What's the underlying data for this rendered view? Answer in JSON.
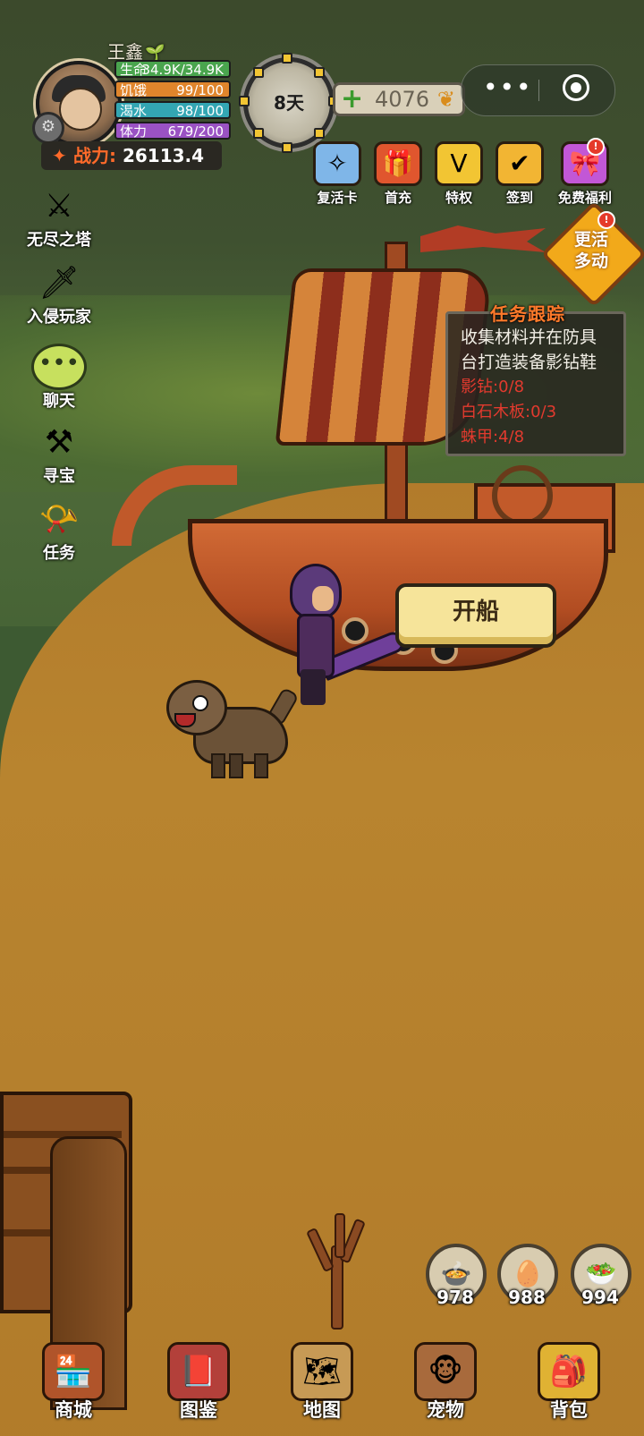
{
  "player": {
    "name": "王鑫",
    "stats": {
      "life": {
        "label": "生命",
        "value": "34.9K/34.9K"
      },
      "hunger": {
        "label": "饥饿",
        "value": "99/100"
      },
      "thirst": {
        "label": "渴水",
        "value": "98/100"
      },
      "stamina": {
        "label": "体力",
        "value": "679/200"
      }
    },
    "power_label": "战力:",
    "power_value": "26113.4"
  },
  "day": {
    "label": "8天"
  },
  "currency": {
    "amount": "4076"
  },
  "top_icons": [
    {
      "label": "复活卡",
      "icon": "angel-wings-icon",
      "color": "#7fb6e8"
    },
    {
      "label": "首充",
      "icon": "gift-box-icon",
      "color": "#e0562e"
    },
    {
      "label": "特权",
      "icon": "diamond-v-icon",
      "color": "#f2c533"
    },
    {
      "label": "签到",
      "icon": "checkmark-cup-icon",
      "color": "#f2b533"
    },
    {
      "label": "免费福利",
      "icon": "gift-icon",
      "color": "#c257d6"
    }
  ],
  "more_activities": {
    "line1": "更活",
    "line2": "多动"
  },
  "left_menu": [
    {
      "label": "无尽之塔",
      "icon": "crossed-swords-icon"
    },
    {
      "label": "入侵玩家",
      "icon": "sword-helmet-icon"
    },
    {
      "label": "聊天",
      "icon": "chat-bubble-icon"
    },
    {
      "label": "寻宝",
      "icon": "treasure-icon"
    },
    {
      "label": "任务",
      "icon": "horn-icon"
    }
  ],
  "quest": {
    "title": "任务跟踪",
    "desc_line1": "收集材料并在防具",
    "desc_line2": "台打造装备影钻鞋",
    "requirements": [
      "影钻:0/8",
      "白石木板:0/3",
      "蛛甲:4/8"
    ]
  },
  "action_button": "开船",
  "consumables": [
    {
      "count": "978",
      "icon": "food-plate-icon"
    },
    {
      "count": "988",
      "icon": "egg-bowl-icon"
    },
    {
      "count": "994",
      "icon": "salad-icon"
    }
  ],
  "bottom_nav": [
    {
      "label": "商城",
      "icon": "shop-icon",
      "color": "#b0542a"
    },
    {
      "label": "图鉴",
      "icon": "book-icon",
      "color": "#b3403a"
    },
    {
      "label": "地图",
      "icon": "map-icon",
      "color": "#c79a55"
    },
    {
      "label": "宠物",
      "icon": "monkey-icon",
      "color": "#a86a3c"
    },
    {
      "label": "背包",
      "icon": "backpack-icon",
      "color": "#e0b233"
    }
  ]
}
